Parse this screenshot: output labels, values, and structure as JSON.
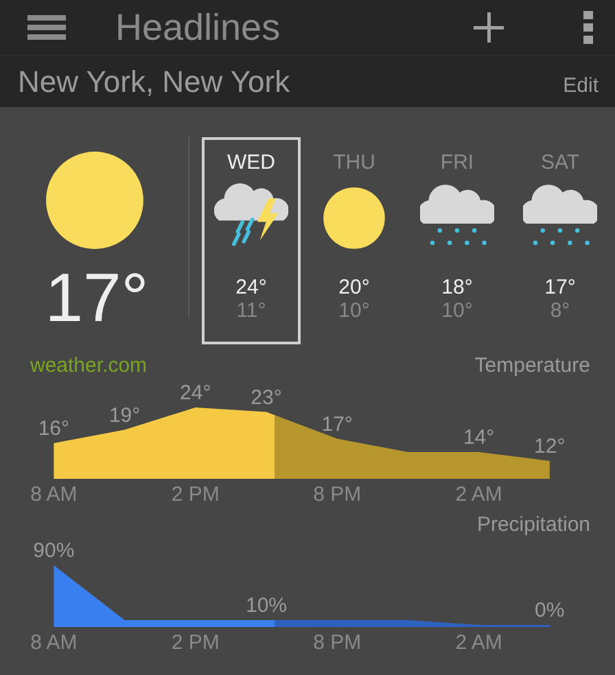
{
  "app_bar": {
    "title": "Headlines"
  },
  "location": {
    "name": "New York, New York",
    "action": "Edit"
  },
  "current": {
    "kind": "sunny",
    "temperature": "17°"
  },
  "forecast": [
    {
      "day": "WED",
      "kind": "storm",
      "high": "24°",
      "low": "11°",
      "selected": true
    },
    {
      "day": "THU",
      "kind": "sunny",
      "high": "20°",
      "low": "10°",
      "selected": false
    },
    {
      "day": "FRI",
      "kind": "flurries",
      "high": "18°",
      "low": "10°",
      "selected": false
    },
    {
      "day": "SAT",
      "kind": "flurries",
      "high": "17°",
      "low": "8°",
      "selected": false
    }
  ],
  "source": "weather.com",
  "charts": [
    {
      "chart_data": {
        "type": "area",
        "title": "Temperature",
        "categories": [
          "8 AM",
          null,
          "2 PM",
          null,
          "8 PM",
          null,
          "2 AM",
          null
        ],
        "values": [
          16,
          19,
          24,
          23,
          17,
          14,
          14,
          12
        ],
        "value_labels": [
          "16°",
          "19°",
          "24°",
          "23°",
          "17°",
          null,
          "14°",
          "12°"
        ]
      }
    },
    {
      "chart_data": {
        "type": "area",
        "title": "Precipitation",
        "categories": [
          "8 AM",
          null,
          "2 PM",
          null,
          "8 PM",
          null,
          "2 AM",
          null
        ],
        "values": [
          90,
          10,
          10,
          10,
          10,
          10,
          0,
          0
        ],
        "value_labels": [
          "90%",
          null,
          null,
          "10%",
          null,
          null,
          null,
          "0%"
        ]
      }
    }
  ]
}
